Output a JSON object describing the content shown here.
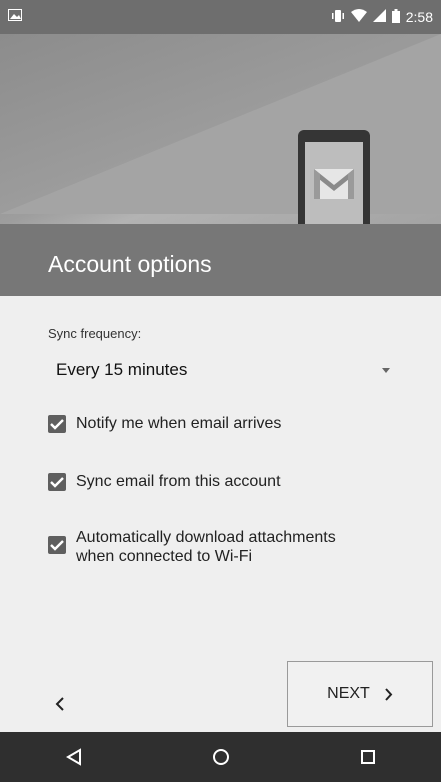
{
  "status_bar": {
    "time": "2:58",
    "icons": [
      "image-icon",
      "vibrate-icon",
      "wifi-icon",
      "signal-icon",
      "battery-icon"
    ]
  },
  "header": {
    "title": "Account options",
    "illustration": "phone-mail-icon"
  },
  "form": {
    "sync_label": "Sync frequency:",
    "sync_value": "Every 15 minutes",
    "options": [
      {
        "label": "Notify me when email arrives",
        "checked": true
      },
      {
        "label": "Sync email from this account",
        "checked": true
      },
      {
        "label": "Automatically download attachments when connected to Wi-Fi",
        "checked": true
      }
    ]
  },
  "footer": {
    "back_icon": "chevron-left-icon",
    "next_label": "NEXT",
    "next_icon": "chevron-right-icon"
  },
  "nav_bar": {
    "buttons": [
      "back-triangle-icon",
      "home-circle-icon",
      "recents-square-icon"
    ]
  },
  "colors": {
    "status_bar": "#6e6e6e",
    "header_band": "#777777",
    "checkbox": "#5f5f5f",
    "nav_bar": "#2f2f2f"
  }
}
